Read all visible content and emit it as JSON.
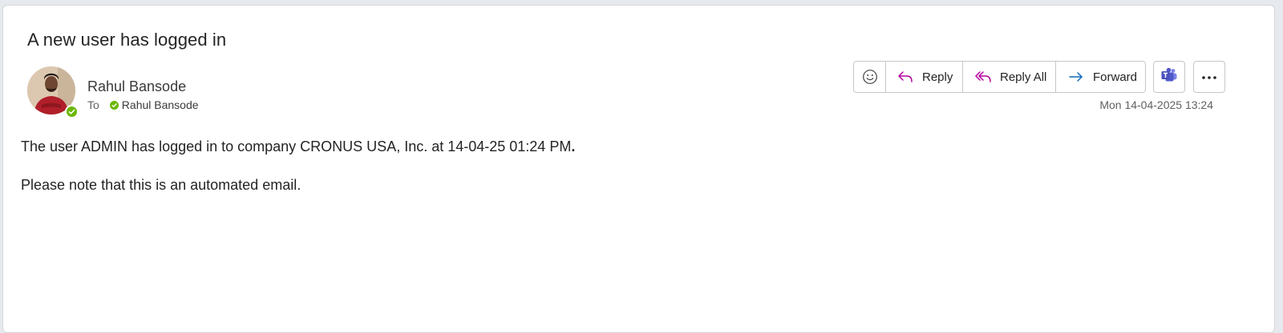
{
  "email": {
    "subject": "A new user has logged in",
    "sender_name": "Rahul Bansode",
    "to_label": "To",
    "recipient_name": "Rahul Bansode",
    "timestamp": "Mon 14-04-2025 13:24",
    "body_line1": "The user ADMIN has logged in to company CRONUS USA, Inc. at 14-04-25 01:24 PM",
    "body_line1_end": ".",
    "body_line2": "Please note that this is an automated email."
  },
  "actions": {
    "reply_label": "Reply",
    "reply_all_label": "Reply All",
    "forward_label": "Forward"
  },
  "icons": {
    "emoji": "smiley-icon",
    "reply": "reply-arrow-icon",
    "reply_all": "reply-all-arrow-icon",
    "forward": "forward-arrow-icon",
    "teams": "teams-icon",
    "more": "more-horizontal-icon",
    "presence": "available-presence-icon"
  },
  "colors": {
    "reply_icon": "#b4009e",
    "forward_icon": "#0f6cbd",
    "teams": "#5059c9",
    "presence_available": "#6bb700"
  }
}
